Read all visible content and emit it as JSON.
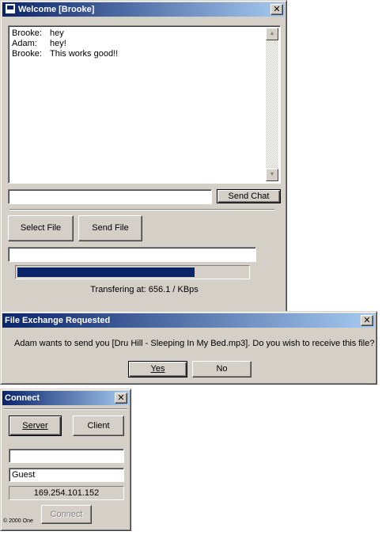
{
  "chat_window": {
    "title": "Welcome [Brooke]",
    "messages": [
      {
        "name": "Brooke:",
        "text": "hey"
      },
      {
        "name": "Adam:",
        "text": "hey!"
      },
      {
        "name": "Brooke:",
        "text": "This works good!!"
      }
    ],
    "message_input_value": "",
    "send_chat_label": "Send Chat",
    "select_file_label": "Select File",
    "send_file_label": "Send File",
    "file_path_value": "",
    "progress_fraction": 0.77,
    "transfer_status": "Transfering at: 656.1 / KBps"
  },
  "file_dialog": {
    "title": "File Exchange Requested",
    "message": "Adam wants to send you [Dru Hill - Sleeping In My Bed.mp3].  Do you wish to receive this file?",
    "yes_label": "Yes",
    "no_label": "No"
  },
  "connect_window": {
    "title": "Connect",
    "server_label": "Server",
    "client_label": "Client",
    "host_value": "",
    "name_value": "Guest",
    "ip_address": "169.254.101.152",
    "copyright": "© 2000 One",
    "connect_label": "Connect"
  },
  "icons": {
    "close": "close-icon",
    "scroll_up": "scroll-up-arrow-icon",
    "scroll_down": "scroll-down-arrow-icon"
  },
  "colors": {
    "titlebar_active": "#0a246a",
    "face": "#d4d0c8",
    "progress": "#0a246a"
  }
}
